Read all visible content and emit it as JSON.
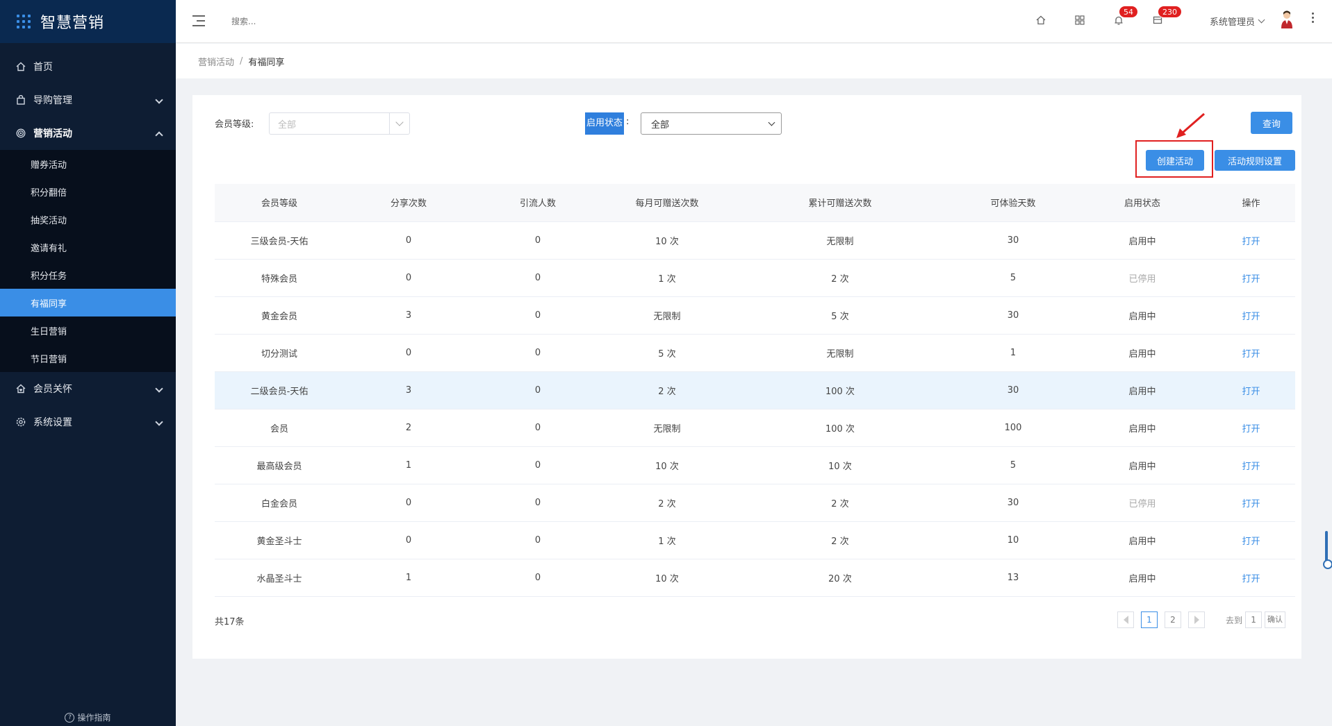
{
  "app": {
    "title": "智慧营销"
  },
  "sidebar": {
    "menu": [
      {
        "label": "首页",
        "icon": "home-icon"
      },
      {
        "label": "导购管理",
        "icon": "bag-icon"
      },
      {
        "label": "营销活动",
        "icon": "target-icon"
      },
      {
        "label": "会员关怀",
        "icon": "heart-home-icon"
      },
      {
        "label": "系统设置",
        "icon": "gear-icon"
      }
    ],
    "submenu": [
      "赠券活动",
      "积分翻倍",
      "抽奖活动",
      "邀请有礼",
      "积分任务",
      "有福同享",
      "生日营销",
      "节日营销"
    ],
    "active_submenu": "有福同享",
    "guide_label": "操作指南"
  },
  "header": {
    "search_placeholder": "搜索...",
    "notifications_count": "54",
    "messages_count": "230",
    "user_name": "系统管理员"
  },
  "breadcrumb": {
    "parent": "营销活动",
    "separator": "/",
    "current": "有福同享"
  },
  "filters": {
    "level_label": "会员等级:",
    "level_placeholder": "全部",
    "status_label": "启用状态",
    "status_colon": ":",
    "status_value": "全部",
    "query_button": "查询",
    "create_button": "创建活动",
    "rules_button": "活动规则设置"
  },
  "table": {
    "columns": [
      "会员等级",
      "分享次数",
      "引流人数",
      "每月可赠送次数",
      "累计可赠送次数",
      "可体验天数",
      "启用状态",
      "操作"
    ],
    "rows": [
      [
        "三级会员-天佑",
        "0",
        "0",
        "10 次",
        "无限制",
        "30",
        "启用中",
        "打开"
      ],
      [
        "特殊会员",
        "0",
        "0",
        "1 次",
        "2 次",
        "5",
        "已停用",
        "打开"
      ],
      [
        "黄金会员",
        "3",
        "0",
        "无限制",
        "5 次",
        "30",
        "启用中",
        "打开"
      ],
      [
        "切分测试",
        "0",
        "0",
        "5 次",
        "无限制",
        "1",
        "启用中",
        "打开"
      ],
      [
        "二级会员-天佑",
        "3",
        "0",
        "2 次",
        "100 次",
        "30",
        "启用中",
        "打开"
      ],
      [
        "会员",
        "2",
        "0",
        "无限制",
        "100 次",
        "100",
        "启用中",
        "打开"
      ],
      [
        "最高级会员",
        "1",
        "0",
        "10 次",
        "10 次",
        "5",
        "启用中",
        "打开"
      ],
      [
        "白金会员",
        "0",
        "0",
        "2 次",
        "2 次",
        "30",
        "已停用",
        "打开"
      ],
      [
        "黄金圣斗士",
        "0",
        "0",
        "1 次",
        "2 次",
        "10",
        "启用中",
        "打开"
      ],
      [
        "水晶圣斗士",
        "1",
        "0",
        "10 次",
        "20 次",
        "13",
        "启用中",
        "打开"
      ]
    ],
    "highlighted_row": 4
  },
  "pagination": {
    "total": "共17条",
    "pages": [
      "1",
      "2"
    ],
    "current_page": "1",
    "goto_label": "去到",
    "goto_value": "1",
    "confirm_label": "确认"
  },
  "colors": {
    "sidebar_bg": "#0e1d33",
    "accent": "#3a8ee6",
    "badge": "#e02020",
    "highlight_box": "#e02020"
  }
}
